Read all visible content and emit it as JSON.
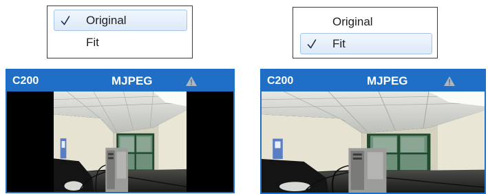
{
  "left": {
    "menu": {
      "items": [
        {
          "label": "Original",
          "checked": true
        },
        {
          "label": "Fit",
          "checked": false
        }
      ]
    },
    "camera": {
      "name": "C200",
      "codec": "MJPEG",
      "status_icon": "warning-triangle-icon",
      "video_fit": false
    }
  },
  "right": {
    "menu": {
      "items": [
        {
          "label": "Original",
          "checked": false
        },
        {
          "label": "Fit",
          "checked": true
        }
      ]
    },
    "camera": {
      "name": "C200",
      "codec": "MJPEG",
      "status_icon": "warning-triangle-icon",
      "video_fit": true
    }
  },
  "colors": {
    "header": "#1f6fc6",
    "menu_highlight": "#dce9f8",
    "check": "#1a2a4a"
  }
}
